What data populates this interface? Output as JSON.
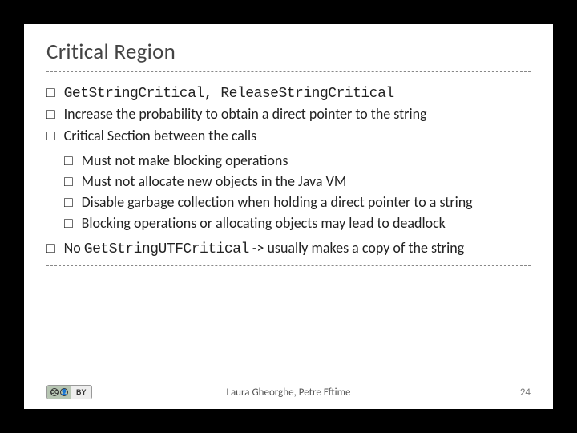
{
  "title": "Critical Region",
  "bullets": {
    "b1_code": "GetStringCritical, ReleaseStringCritical",
    "b2": "Increase the probability to obtain a direct pointer to the string",
    "b3": "Critical Section between the calls",
    "sub": {
      "s1": "Must not make blocking operations",
      "s2": "Must not allocate new objects in the Java VM",
      "s3": "Disable garbage collection when holding a direct pointer to a string",
      "s4": "Blocking operations or allocating objects may lead to deadlock"
    },
    "b4_pre": "No ",
    "b4_code": "GetStringUTFCritical",
    "b4_post": " -> usually makes a copy of the string"
  },
  "footer": {
    "authors": "Laura Gheorghe, Petre Eftime",
    "page": "24",
    "cc_label": "CC",
    "by_label": "BY"
  }
}
